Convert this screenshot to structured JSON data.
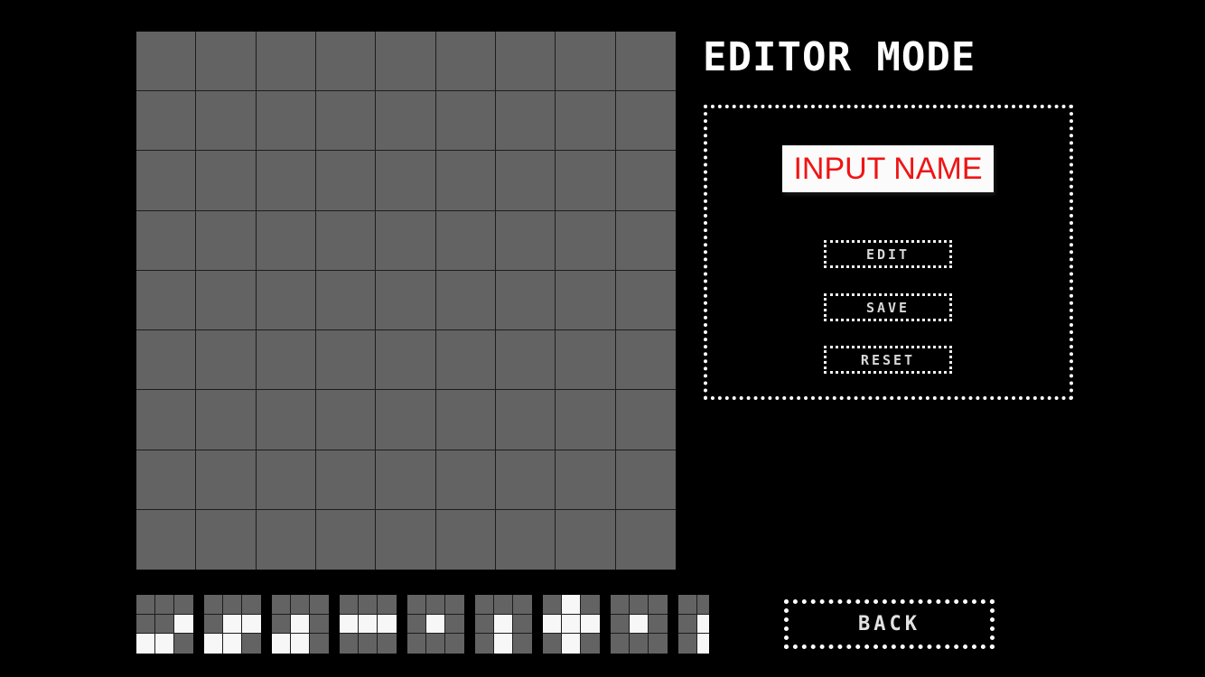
{
  "screen": {
    "background_color": "#000000",
    "mode_title": "EDITOR MODE"
  },
  "grid": {
    "columns": 9,
    "rows": 9,
    "cell_color": "#636363",
    "line_color": "#1d1d1d",
    "cells_filled": []
  },
  "editor_panel": {
    "border_style": "dotted",
    "border_color": "#ffffff",
    "name_input": {
      "value": "INPUT NAME",
      "placeholder": "INPUT NAME",
      "text_color": "#f01414",
      "background_color": "#fbfbfb"
    },
    "buttons": [
      {
        "id": "edit",
        "label": "EDIT"
      },
      {
        "id": "save",
        "label": "SAVE"
      },
      {
        "id": "reset",
        "label": "RESET"
      }
    ]
  },
  "back_button": {
    "label": "BACK"
  },
  "tile_palette": {
    "tile_count": 9,
    "tile_grid": 3,
    "filled_color": "#f7f7f7",
    "empty_color": "#636363",
    "tiles": [
      {
        "index": 0,
        "pattern": [
          [
            0,
            0,
            0
          ],
          [
            0,
            0,
            1
          ],
          [
            1,
            1,
            0
          ]
        ]
      },
      {
        "index": 1,
        "pattern": [
          [
            0,
            0,
            0
          ],
          [
            0,
            1,
            1
          ],
          [
            1,
            1,
            0
          ]
        ]
      },
      {
        "index": 2,
        "pattern": [
          [
            0,
            0,
            0
          ],
          [
            0,
            1,
            0
          ],
          [
            1,
            1,
            0
          ]
        ]
      },
      {
        "index": 3,
        "pattern": [
          [
            0,
            0,
            0
          ],
          [
            1,
            1,
            1
          ],
          [
            0,
            0,
            0
          ]
        ]
      },
      {
        "index": 4,
        "pattern": [
          [
            0,
            0,
            0
          ],
          [
            0,
            1,
            0
          ],
          [
            0,
            0,
            0
          ]
        ]
      },
      {
        "index": 5,
        "pattern": [
          [
            0,
            0,
            0
          ],
          [
            0,
            1,
            0
          ],
          [
            0,
            1,
            0
          ]
        ]
      },
      {
        "index": 6,
        "pattern": [
          [
            0,
            1,
            0
          ],
          [
            1,
            1,
            1
          ],
          [
            0,
            1,
            0
          ]
        ]
      },
      {
        "index": 7,
        "pattern": [
          [
            0,
            0,
            0
          ],
          [
            0,
            1,
            0
          ],
          [
            0,
            0,
            0
          ]
        ]
      },
      {
        "index": 8,
        "pattern": [
          [
            0,
            0,
            0
          ],
          [
            0,
            1,
            0
          ],
          [
            0,
            1,
            0
          ]
        ]
      }
    ]
  }
}
